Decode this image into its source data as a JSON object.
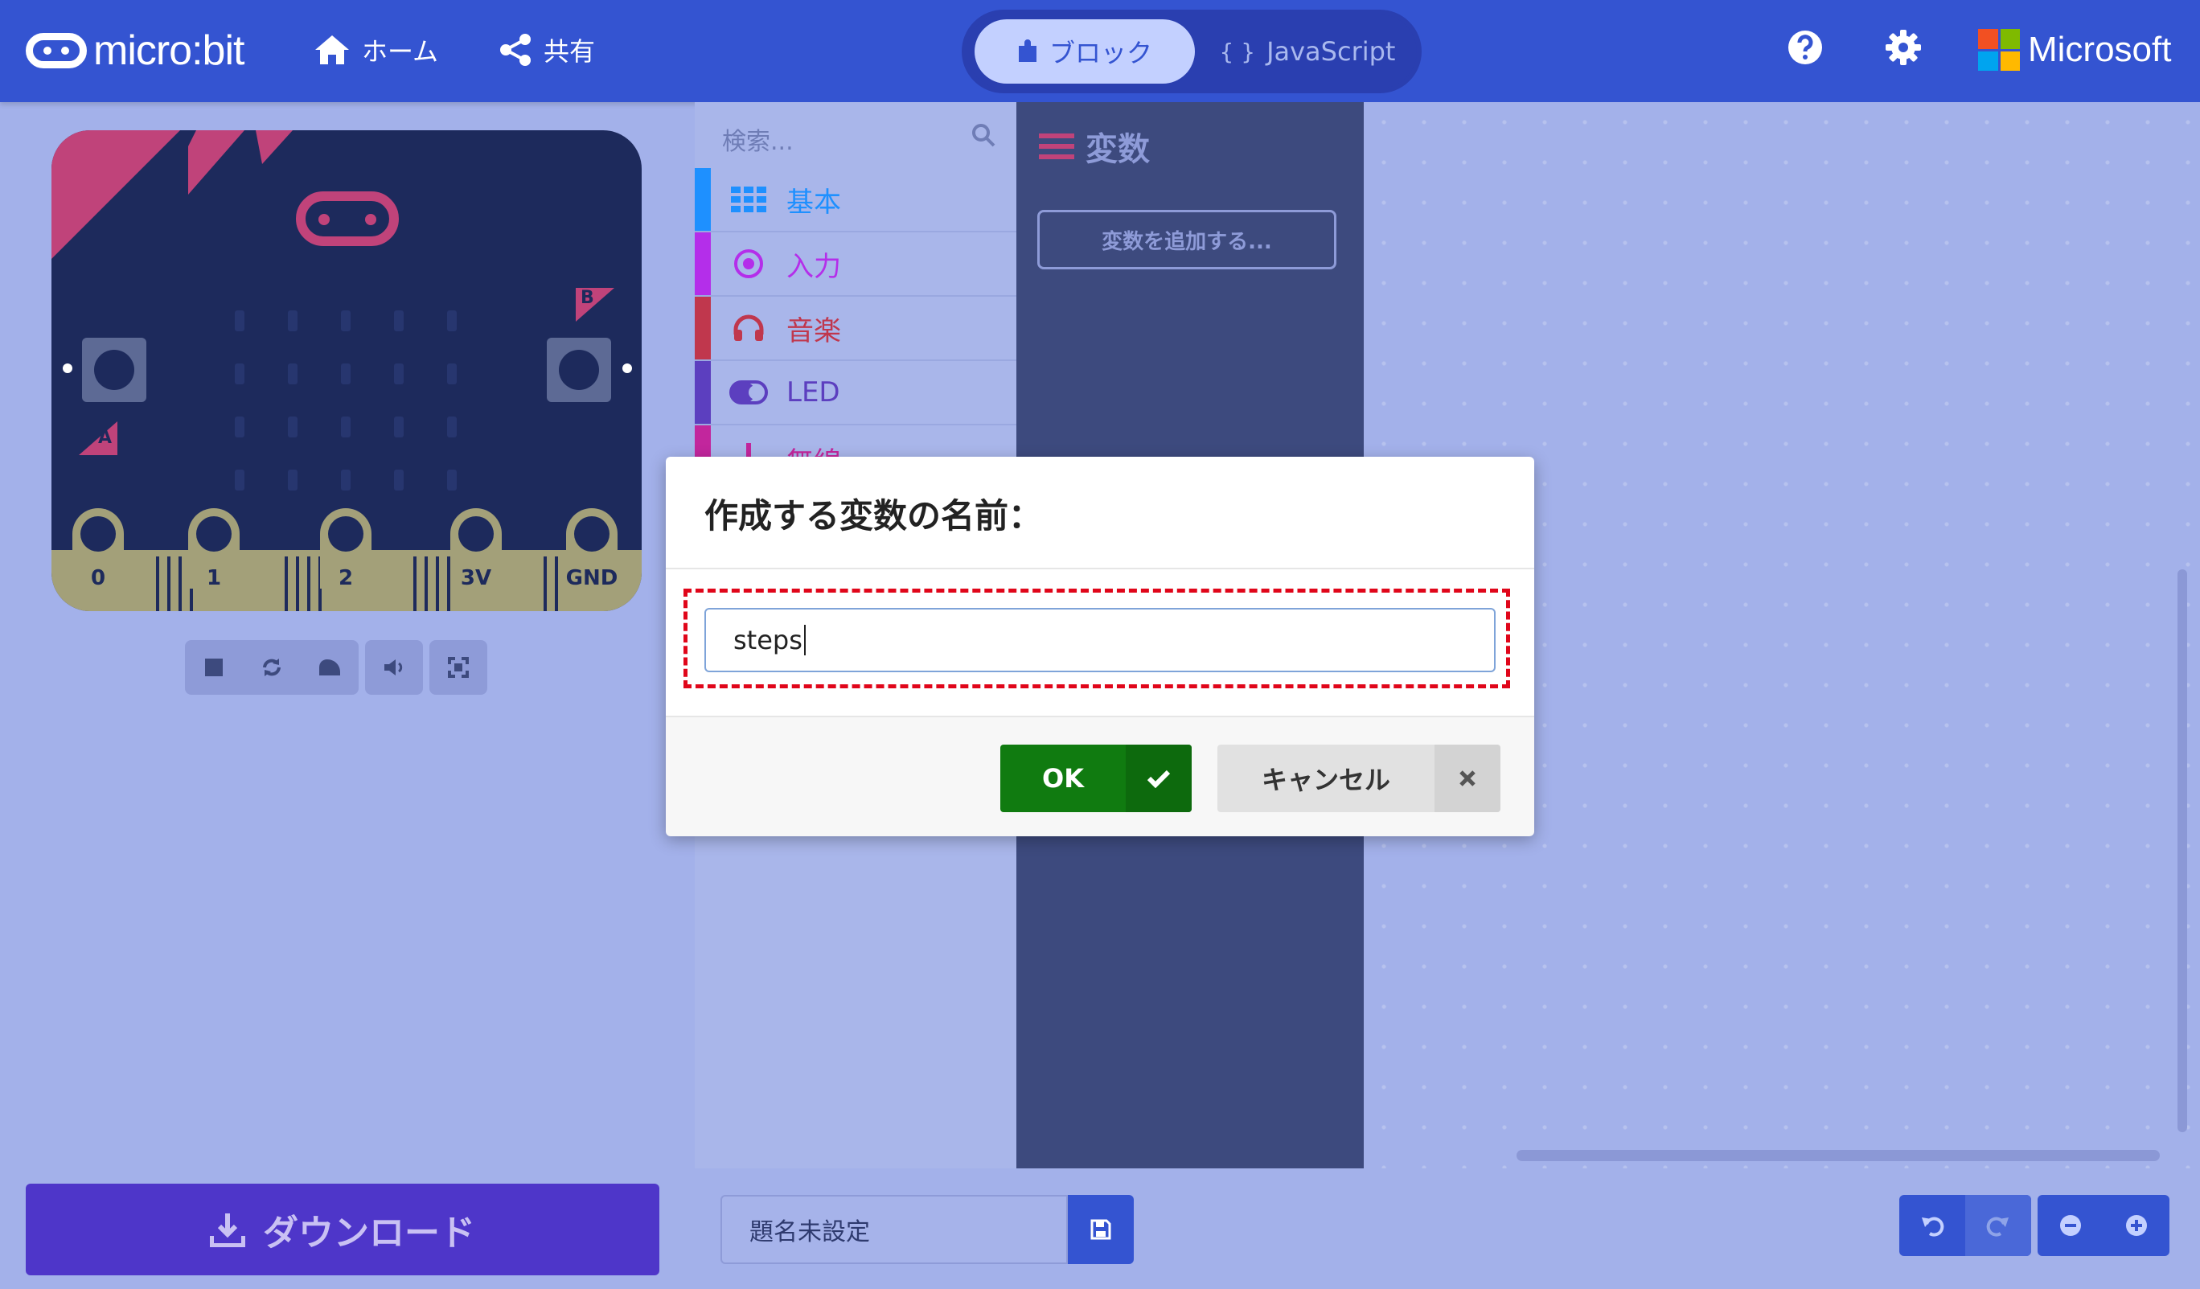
{
  "header": {
    "logo_text": "micro:bit",
    "home_label": "ホーム",
    "share_label": "共有",
    "blocks_label": "ブロック",
    "js_label": "JavaScript",
    "js_glyph": "{ }",
    "brand_label": "Microsoft"
  },
  "simulator": {
    "pins": [
      "0",
      "1",
      "2",
      "3V",
      "GND"
    ],
    "button_a": "A",
    "button_b": "B"
  },
  "toolbox": {
    "search_placeholder": "検索...",
    "categories": [
      {
        "label": "基本",
        "color": "#1e90ff",
        "icon": "grid-icon"
      },
      {
        "label": "入力",
        "color": "#b42eea",
        "icon": "target-icon"
      },
      {
        "label": "音楽",
        "color": "#c0374d",
        "icon": "headphones-icon"
      },
      {
        "label": "LED",
        "color": "#5c3fbf",
        "icon": "toggle-icon"
      },
      {
        "label": "無線",
        "color": "#c2269d",
        "icon": "signal-icon"
      }
    ]
  },
  "flyout": {
    "title": "変数",
    "add_variable_label": "変数を追加する..."
  },
  "dialog": {
    "title": "作成する変数の名前：",
    "input_value": "steps",
    "ok_label": "OK",
    "cancel_label": "キャンセル"
  },
  "footer": {
    "download_label": "ダウンロード",
    "project_name": "題名未設定"
  }
}
